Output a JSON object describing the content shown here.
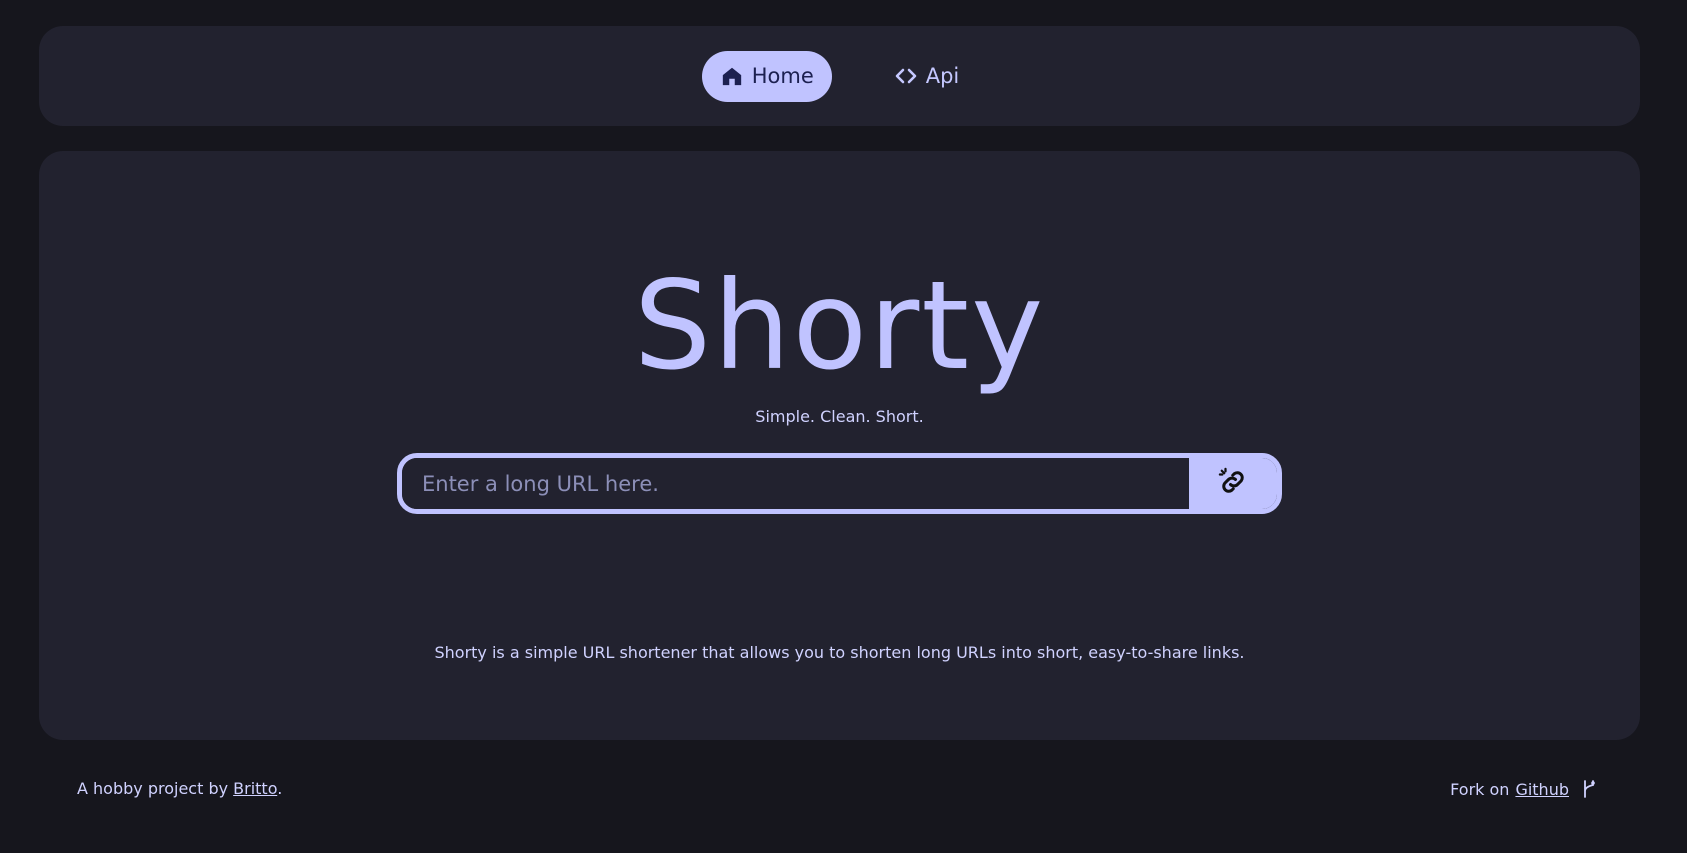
{
  "nav": {
    "items": [
      {
        "label": "Home",
        "icon": "home-icon",
        "active": true
      },
      {
        "label": "Api",
        "icon": "code-icon",
        "active": false
      }
    ]
  },
  "hero": {
    "title": "Shorty",
    "tagline": "Simple. Clean. Short."
  },
  "form": {
    "url_placeholder": "Enter a long URL here.",
    "url_value": "",
    "submit_icon": "link-icon"
  },
  "description": "Shorty is a simple URL shortener that allows you to shorten long URLs into short, easy-to-share links.",
  "footer": {
    "left_prefix": "A hobby project by ",
    "author_link": "Britto",
    "left_suffix": ".",
    "right_prefix": "Fork on ",
    "github_link": "Github",
    "fork_icon": "git-fork-icon"
  },
  "colors": {
    "background": "#16161d",
    "panel": "#22222f",
    "accent": "#c0c3ff",
    "text": "#d0d2ff"
  }
}
